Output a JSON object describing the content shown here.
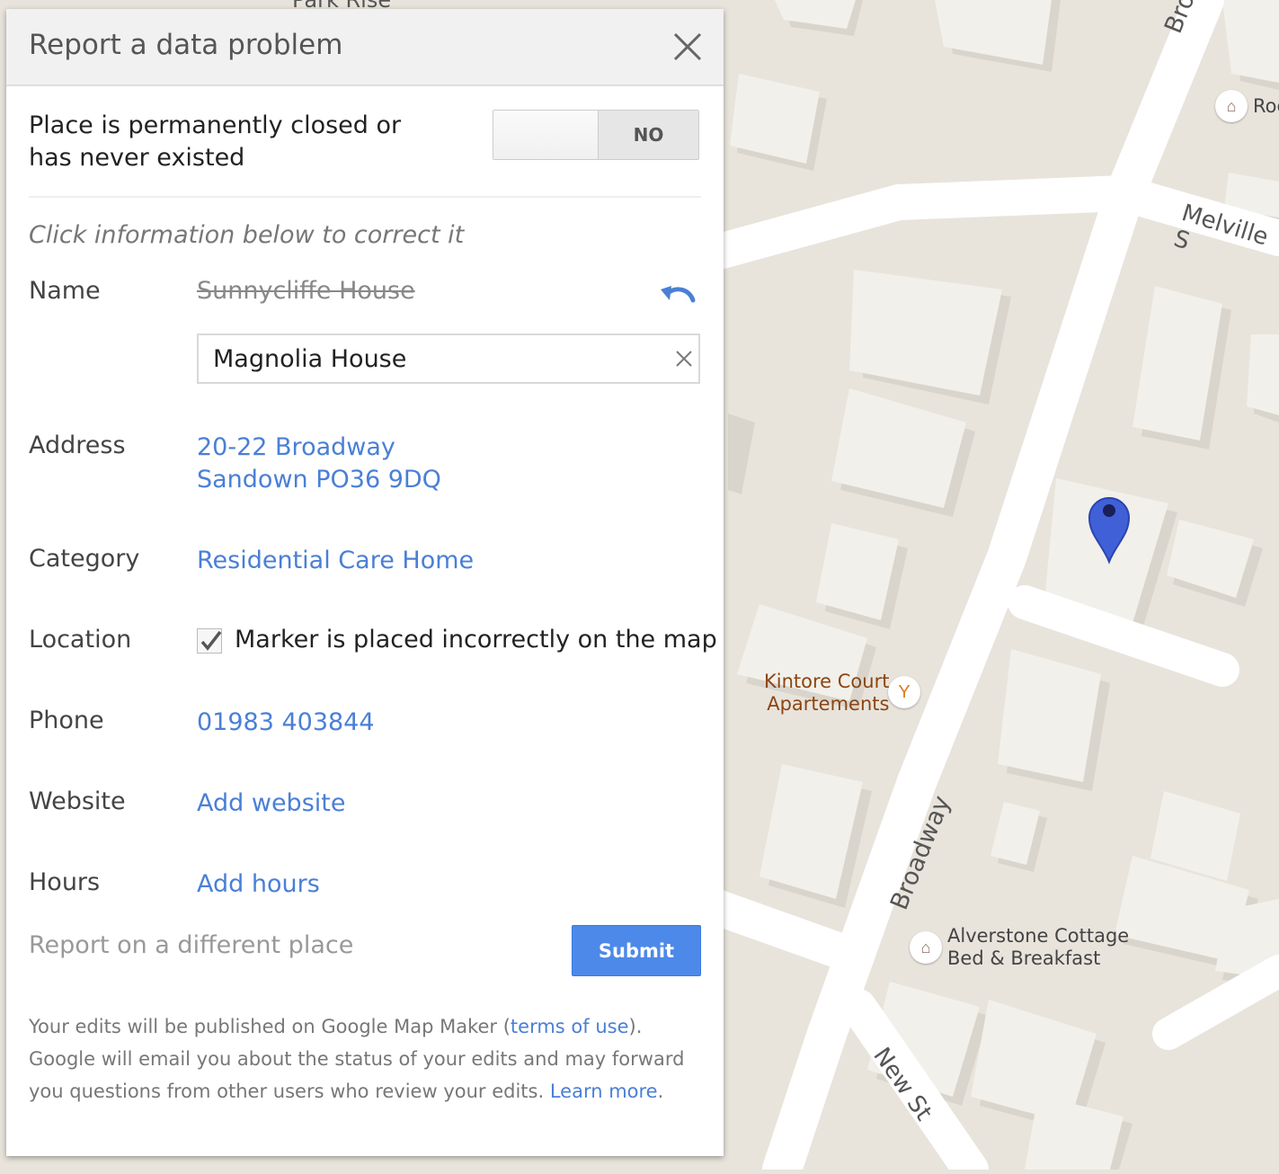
{
  "dialog": {
    "title": "Report a data problem",
    "closed_question": "Place is permanently closed or has never existed",
    "toggle_value": "NO",
    "instruction": "Click information below to correct it",
    "fields": {
      "name": {
        "label": "Name",
        "old_value": "Sunnycliffe House",
        "new_value": "Magnolia House"
      },
      "address": {
        "label": "Address",
        "line1": "20-22 Broadway",
        "line2": "Sandown PO36 9DQ"
      },
      "category": {
        "label": "Category",
        "value": "Residential Care Home"
      },
      "location": {
        "label": "Location",
        "checkbox_label": "Marker is placed incorrectly on the map",
        "checked": true
      },
      "phone": {
        "label": "Phone",
        "value": "01983 403844"
      },
      "website": {
        "label": "Website",
        "value": "Add website"
      },
      "hours": {
        "label": "Hours",
        "value": "Add hours"
      }
    },
    "different_place": "Report on a different place",
    "submit_label": "Submit",
    "footer": {
      "part1": "Your edits will be published on Google Map Maker (",
      "terms_link": "terms of use",
      "part2": "). Google will email you about the status of your edits and may forward you questions from other users who review your edits. ",
      "learn_more": "Learn more",
      "part3": "."
    }
  },
  "map": {
    "street_labels": [
      "Broadway",
      "Broadway",
      "Melville S",
      "New St",
      "Park Rise"
    ],
    "pois": [
      {
        "name_line1": "Kintore Court",
        "name_line2": "Apartements",
        "icon": "cocktail-icon"
      },
      {
        "name_line1": "Alverstone Cottage",
        "name_line2": "Bed & Breakfast",
        "icon": "bed-icon"
      },
      {
        "name_line1": "Roc",
        "icon": "bed-icon"
      }
    ],
    "colors": {
      "land": "#e8e4dc",
      "building": "#f2f0ea",
      "road": "#ffffff",
      "marker": "#4060d8",
      "poi_text": "#8b4513",
      "link": "#4a7fd6",
      "submit": "#4d89e9"
    }
  }
}
